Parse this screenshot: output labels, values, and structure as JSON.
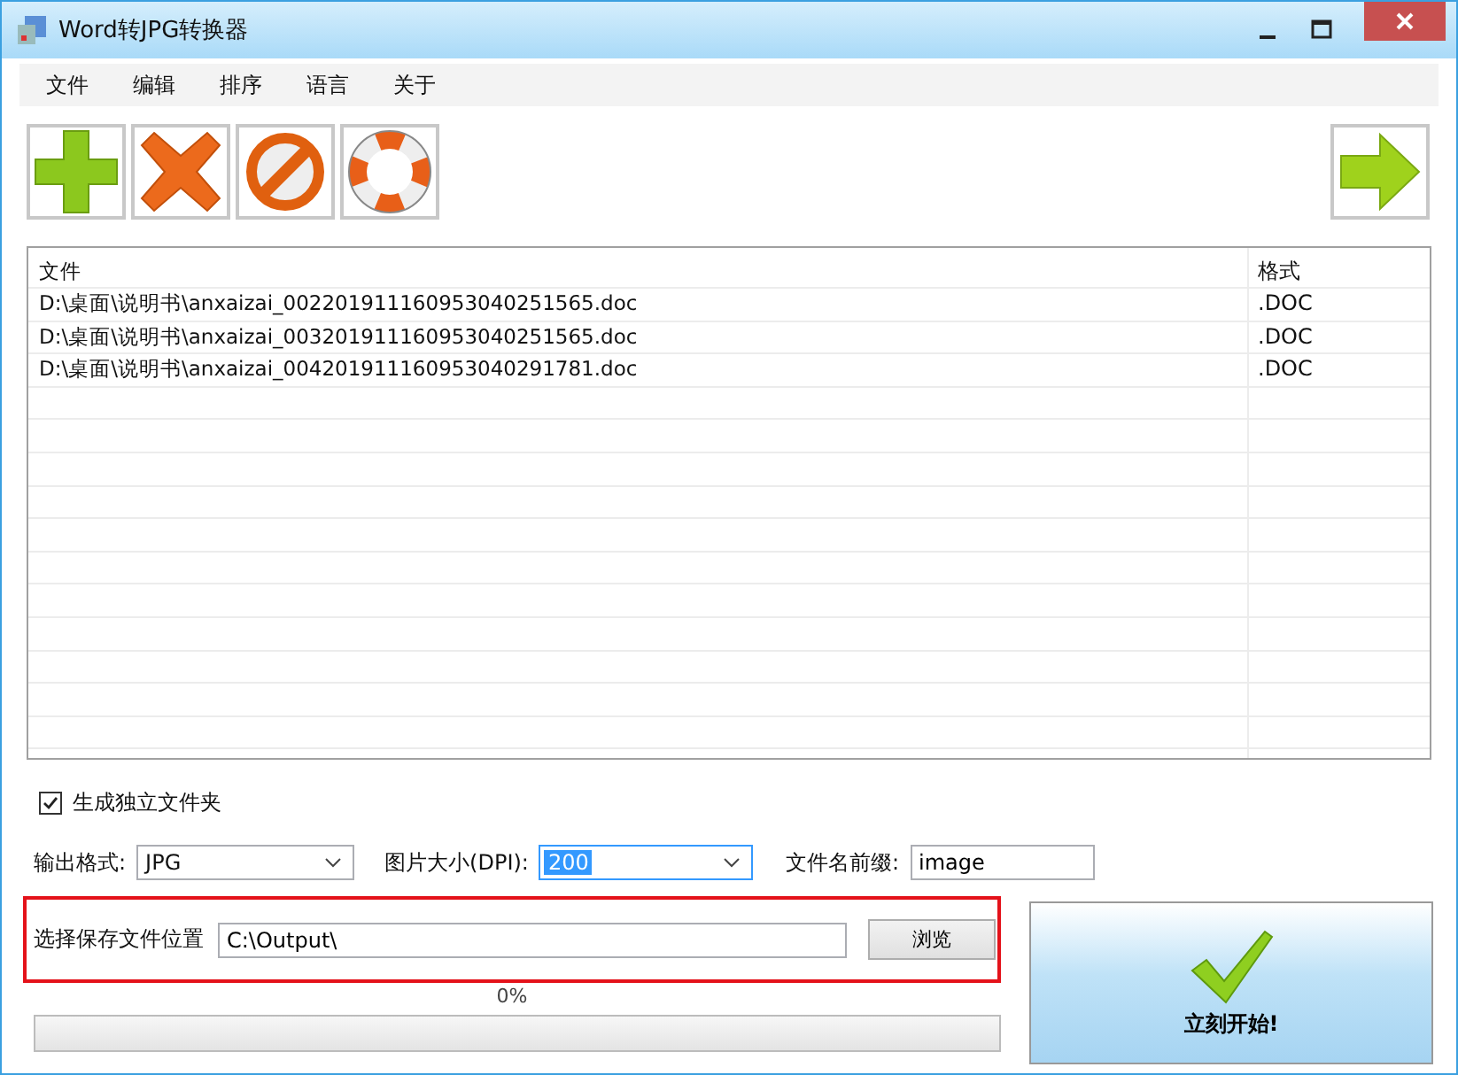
{
  "window": {
    "title": "Word转JPG转换器"
  },
  "menu": [
    "文件",
    "编辑",
    "排序",
    "语言",
    "关于"
  ],
  "table": {
    "columns": [
      "文件",
      "格式"
    ],
    "rows": [
      [
        "D:\\桌面\\说明书\\anxaizai_002201911160953040251565.doc",
        ".DOC"
      ],
      [
        "D:\\桌面\\说明书\\anxaizai_003201911160953040251565.doc",
        ".DOC"
      ],
      [
        "D:\\桌面\\说明书\\anxaizai_004201911160953040291781.doc",
        ".DOC"
      ]
    ]
  },
  "options": {
    "separate_folder": {
      "label": "生成独立文件夹",
      "checked": true
    },
    "format": {
      "label": "输出格式:",
      "value": "JPG"
    },
    "dpi": {
      "label": "图片大小(DPI):",
      "value": "200",
      "text_selected": true
    },
    "prefix": {
      "label": "文件名前缀:",
      "value": "image"
    }
  },
  "save": {
    "label": "选择保存文件位置",
    "value": "C:\\Output\\",
    "browse": "浏览"
  },
  "progress": {
    "reading": "0%",
    "level": 0
  },
  "start_button": "立刻开始!"
}
